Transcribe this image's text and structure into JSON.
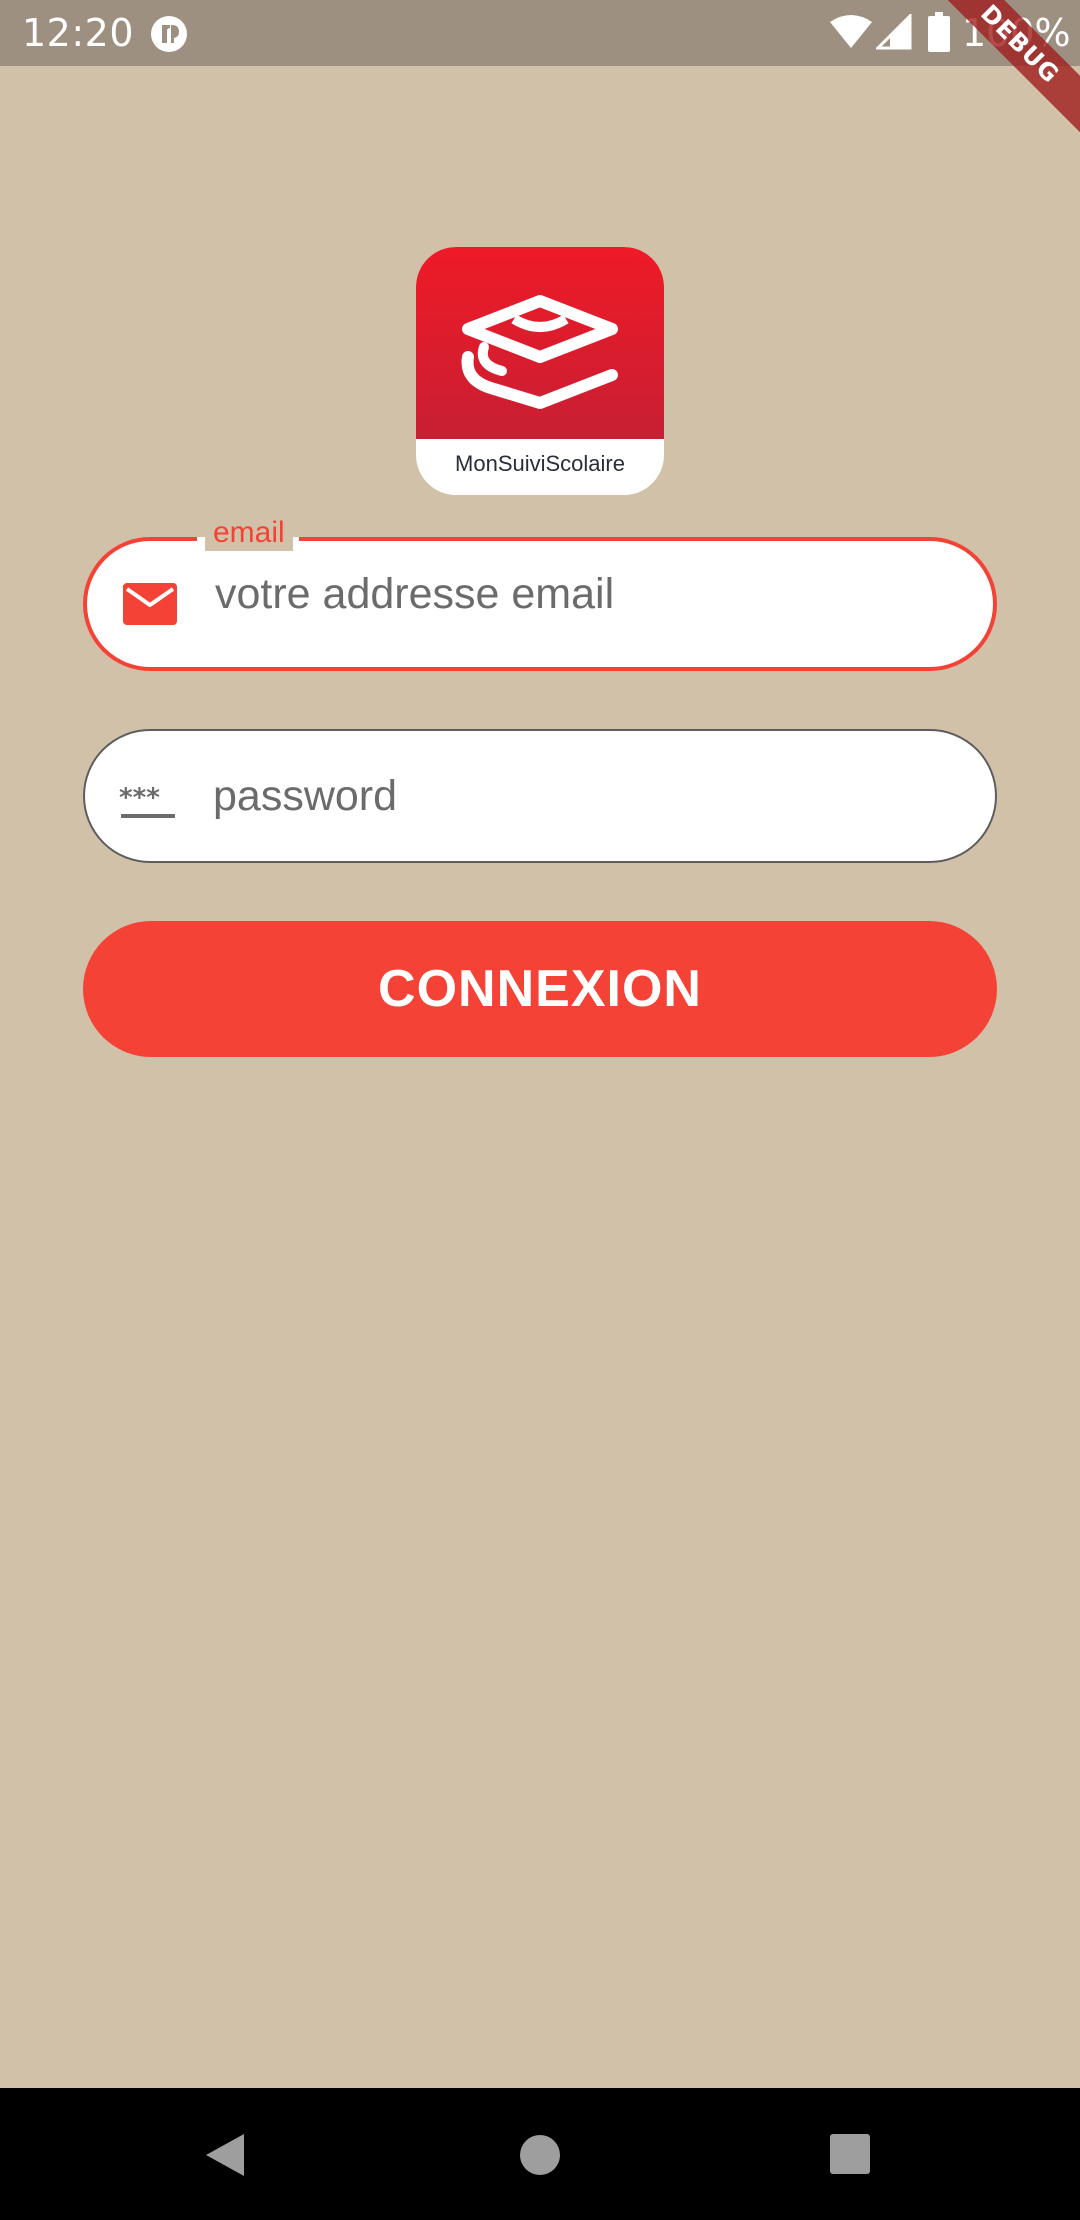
{
  "status_bar": {
    "time": "12:20",
    "battery_text": "100%",
    "icons": [
      "app-notification-icon",
      "wifi-icon",
      "cell-signal-icon",
      "battery-icon"
    ]
  },
  "debug_banner": {
    "label": "DEBUG"
  },
  "logo": {
    "app_name": "MonSuiviScolaire"
  },
  "form": {
    "email": {
      "label": "email",
      "placeholder": "votre addresse email",
      "value": "",
      "icon": "mail-icon"
    },
    "password": {
      "placeholder": "password",
      "value": "",
      "icon": "password-icon"
    },
    "submit_label": "CONNEXION"
  },
  "nav_bar": {
    "icons": [
      "back-icon",
      "home-icon",
      "recents-icon"
    ]
  },
  "colors": {
    "background": "#d1c1a8",
    "accent": "#f44336",
    "status_bar": "#9d9080"
  }
}
